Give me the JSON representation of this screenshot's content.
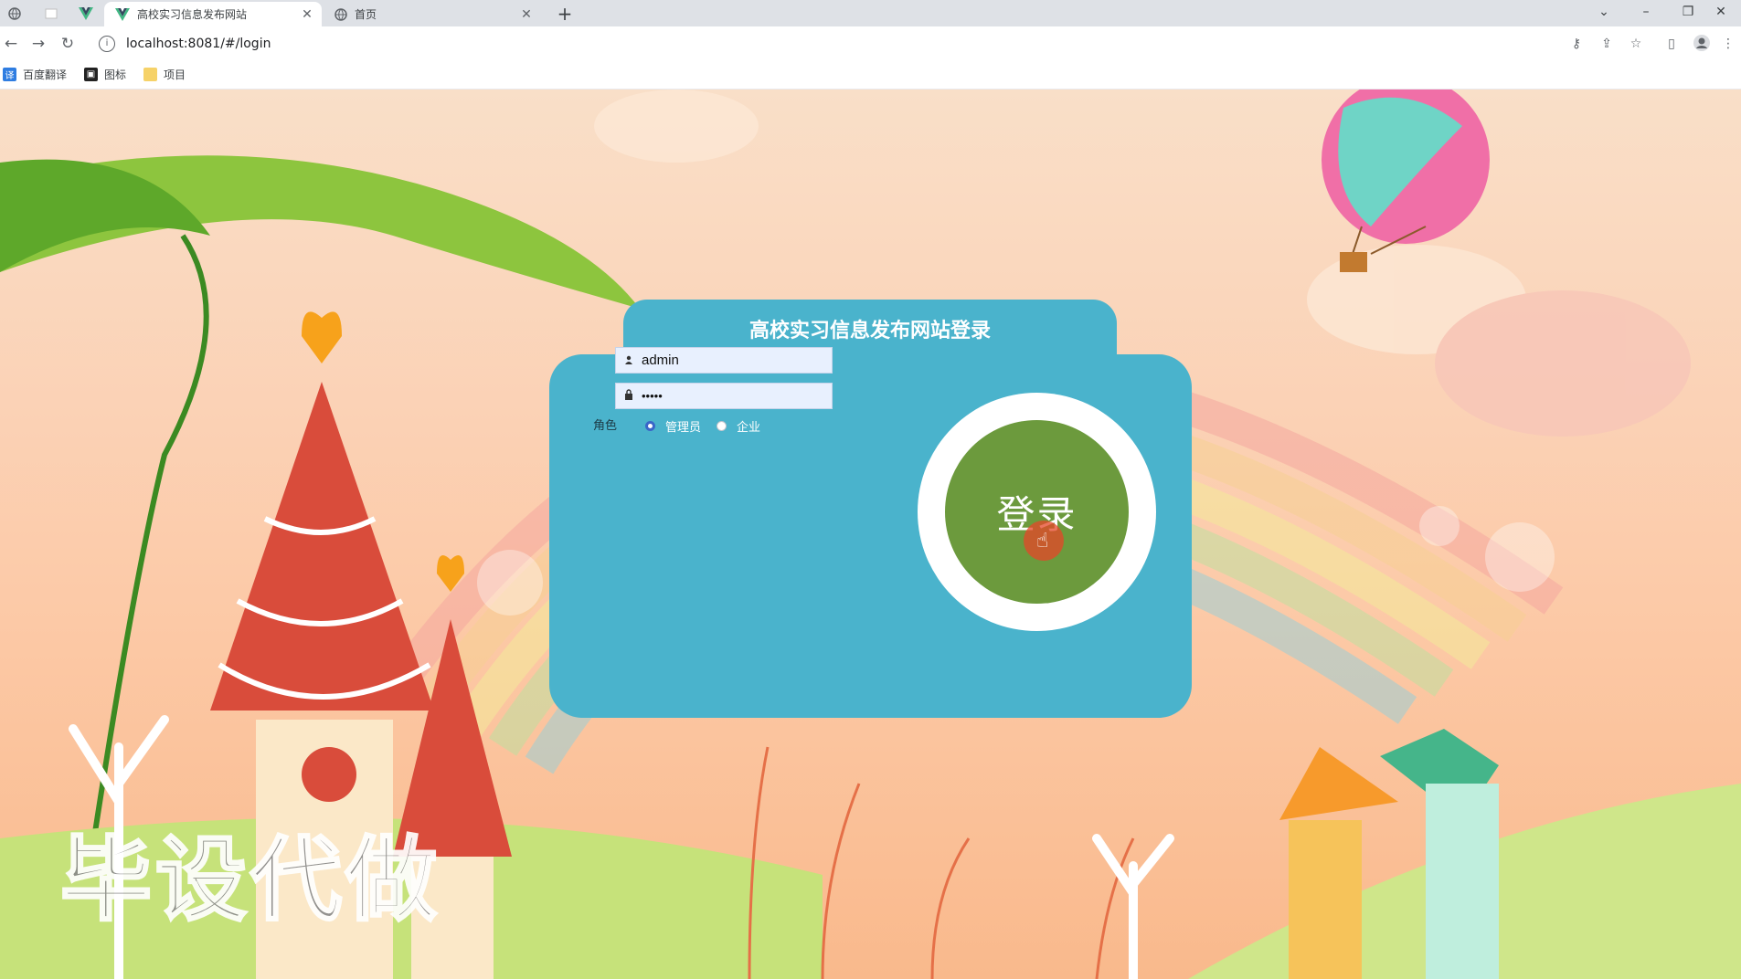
{
  "browser": {
    "tabs": [
      {
        "title": "高校实习信息发布网站",
        "active": true
      },
      {
        "title": "首页",
        "active": false
      }
    ],
    "new_tab": "+",
    "url": "localhost:8081/#/login",
    "window_controls": {
      "dropdown": "⌄",
      "minimize": "–",
      "restore": "❐",
      "close": "✕"
    },
    "bookmarks": [
      {
        "label": "百度翻译",
        "icon": "translate-icon"
      },
      {
        "label": "图标",
        "icon": "image-icon"
      },
      {
        "label": "项目",
        "icon": "folder-icon"
      }
    ]
  },
  "login": {
    "title": "高校实习信息发布网站登录",
    "username": "admin",
    "password": "•••••",
    "role_label": "角色",
    "roles": [
      "管理员",
      "企业"
    ],
    "selected_role": "管理员",
    "submit": "登录"
  },
  "watermark": "毕设代做",
  "colors": {
    "card": "#4ab3cc",
    "button": "#6c9a3d",
    "radio_checked": "#3a66c8"
  }
}
